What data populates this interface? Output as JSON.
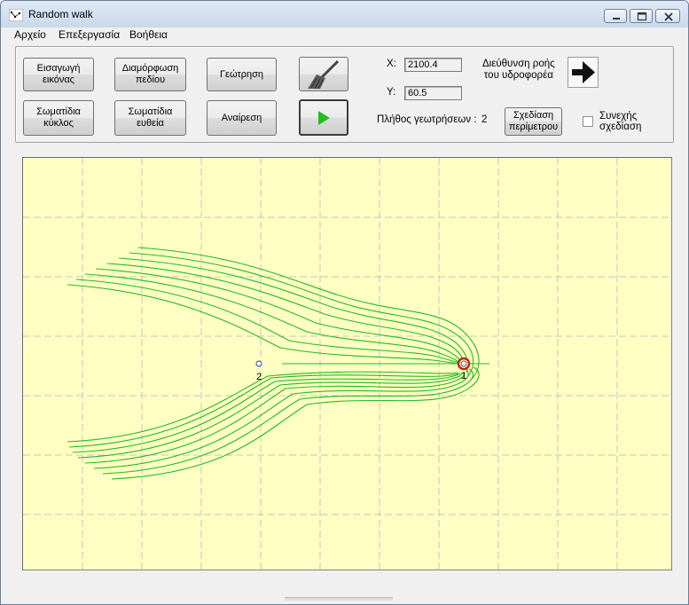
{
  "window": {
    "title": "Random walk"
  },
  "menu": {
    "items": [
      "Αρχείο",
      "Επεξεργασία",
      "Βοήθεια"
    ]
  },
  "toolbar": {
    "import_image": "Εισαγωγή\nεικόνας",
    "field_config": "Διαμόρφωση\nπεδίου",
    "drilling": "Γεώτρηση",
    "particles_circle": "Σωματίδια\nκύκλος",
    "particles_line": "Σωματίδια\nευθεία",
    "undo": "Αναίρεση",
    "draw_perimeter": "Σχεδίαση\nπερίμετρου"
  },
  "coords": {
    "x_label": "X:",
    "x_value": "2100.4",
    "y_label": "Y:",
    "y_value": "60.5"
  },
  "flow": {
    "direction_label": "Διεύθυνση ροής\nτου υδροφορέα",
    "direction": "right",
    "direction_icon": "arrow-right-icon"
  },
  "wells": {
    "count_label": "Πλήθος γεωτρήσεων :",
    "count_value": "2"
  },
  "continuous": {
    "label": "Συνεχής\nσχεδίαση",
    "checked": false
  },
  "icons": {
    "broom": "broom-icon",
    "play": "play-icon"
  },
  "plot": {
    "background": "#ffffc4",
    "grid_color": "#c0c0c0",
    "line_color": "#22bb22",
    "well_markers": [
      {
        "label": "1",
        "style": "pumping-well-red-ring"
      },
      {
        "label": "2",
        "style": "observation-well-blue"
      }
    ]
  },
  "colors": {
    "streamline": "#22bb22",
    "well_ring": "#cc2200",
    "play_green": "#1fbf1f"
  }
}
